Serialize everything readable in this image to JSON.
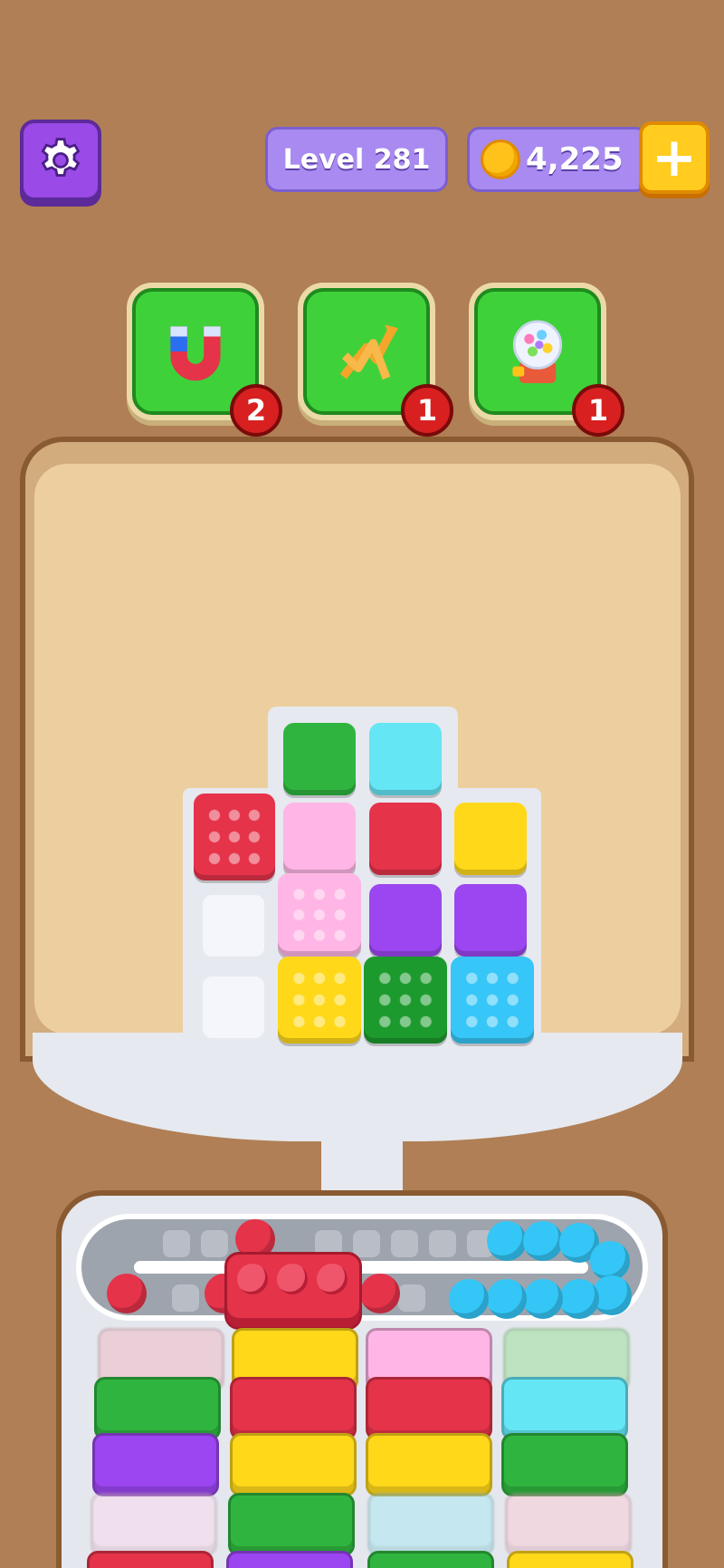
{
  "topbar": {
    "level_label": "Level 281",
    "coins": "4,225",
    "add_coins_label": "+"
  },
  "boosters": [
    {
      "name": "magnet",
      "count": "2"
    },
    {
      "name": "shuffle",
      "count": "1"
    },
    {
      "name": "gumball-machine",
      "count": "1"
    }
  ],
  "colors": {
    "red": "#e5334a",
    "pink": "#ffb6e6",
    "yellow": "#ffd81a",
    "green": "#2fb53f",
    "dark_green": "#1d9a2e",
    "cyan": "#64e6f5",
    "blue": "#36c6f7",
    "purple": "#9b46f0",
    "accent_purple": "#9a4ae6",
    "booster_green": "#3fd13a"
  }
}
